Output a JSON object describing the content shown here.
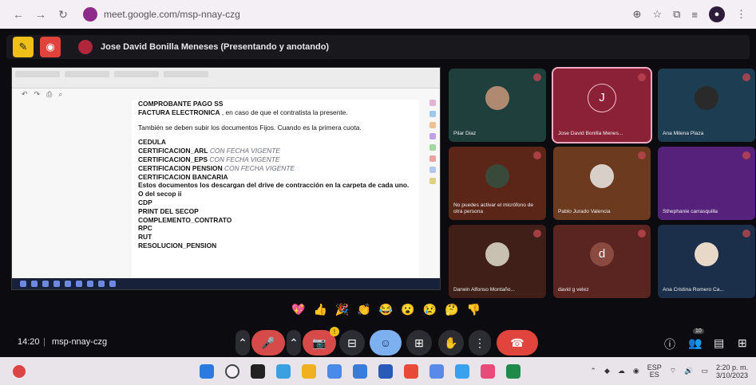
{
  "browser": {
    "url": "meet.google.com/msp-nnay-czg",
    "back": "←",
    "forward": "→",
    "reload": "↻",
    "icons": [
      "zoom-icon",
      "star-icon",
      "extensions-icon",
      "tab-search-icon",
      "profile-icon",
      "menu-icon"
    ]
  },
  "presenting": {
    "text": "Jose David Bonilla Meneses (Presentando y anotando)"
  },
  "document": {
    "lines_bold": [
      "COMPROBANTE PAGO SS",
      "FACTURA ELECTRONICA"
    ],
    "factura_suffix": " , en caso de que el contratista la presente.",
    "para2": "También se deben subir los documentos Fijos. Cuando es la primera cuota.",
    "list": [
      {
        "label": "CEDULA",
        "note": ""
      },
      {
        "label": "CERTIFICACION_ARL",
        "note": "CON FECHA VIGENTE"
      },
      {
        "label": "CERTIFICACION_EPS",
        "note": "CON FECHA VIGENTE"
      },
      {
        "label": "CERTIFICACION PENSION",
        "note": "CON FECHA VIGENTE"
      },
      {
        "label": "CERTIFICACION BANCARIA",
        "note": ""
      }
    ],
    "note_para": "Estos documentos los descargan del drive de contracción en la carpeta de cada uno. O del secop ii",
    "list2": [
      "CDP",
      "PRINT DEL SECOP",
      "COMPLEMENTO_CONTRATO",
      "RPC",
      "RUT",
      "RESOLUCION_PENSION"
    ]
  },
  "participants": [
    {
      "name": "Pilar Diaz",
      "avatar": "",
      "bg": "#1f3f3c",
      "avatarBg": "#b08a70"
    },
    {
      "name": "Jose David Bonilla Menes...",
      "avatar": "J",
      "bg": "#8a2137",
      "avatarBg": "#8a2137"
    },
    {
      "name": "Ana Milena Plaza",
      "avatar": "",
      "bg": "#1d3d52",
      "avatarBg": "#2a2a2a"
    },
    {
      "name": "No puedes activar el micrófono de otra persona",
      "avatar": "",
      "bg": "#5b2617",
      "avatarBg": "#3a4a3a"
    },
    {
      "name": "Pablo Jurado Valencia",
      "avatar": "",
      "bg": "#6b3a1f",
      "avatarBg": "#d8d0c8"
    },
    {
      "name": "Sthephanie carrasquilla",
      "avatar": "",
      "bg": "#55217a",
      "avatarBg": "#55217a"
    },
    {
      "name": "Darwin Alfonso Montaño...",
      "avatar": "",
      "bg": "#3f1f17",
      "avatarBg": "#c8c0b0"
    },
    {
      "name": "david g velez",
      "avatar": "d",
      "bg": "#5a2420",
      "avatarBg": "#8a4a40"
    },
    {
      "name": "Ana Cristina Romero Ca...",
      "avatar": "",
      "bg": "#1b2f4a",
      "avatarBg": "#e8d8c8"
    }
  ],
  "reactions": [
    "💖",
    "👍",
    "🎉",
    "👏",
    "😂",
    "😮",
    "😢",
    "🤔",
    "👎"
  ],
  "controls": {
    "time": "14:20",
    "separator": "|",
    "meeting_code": "msp-nnay-czg",
    "camera_badge": "!",
    "participants_count": "10"
  },
  "taskbar": {
    "lang_top": "ESP",
    "lang_bottom": "ES",
    "time": "2:20 p. m.",
    "date": "3/10/2023"
  },
  "colors": {
    "meet_bg": "#0c0c10",
    "end_call": "#e0443c",
    "active_outline": "#f0a9c0"
  }
}
